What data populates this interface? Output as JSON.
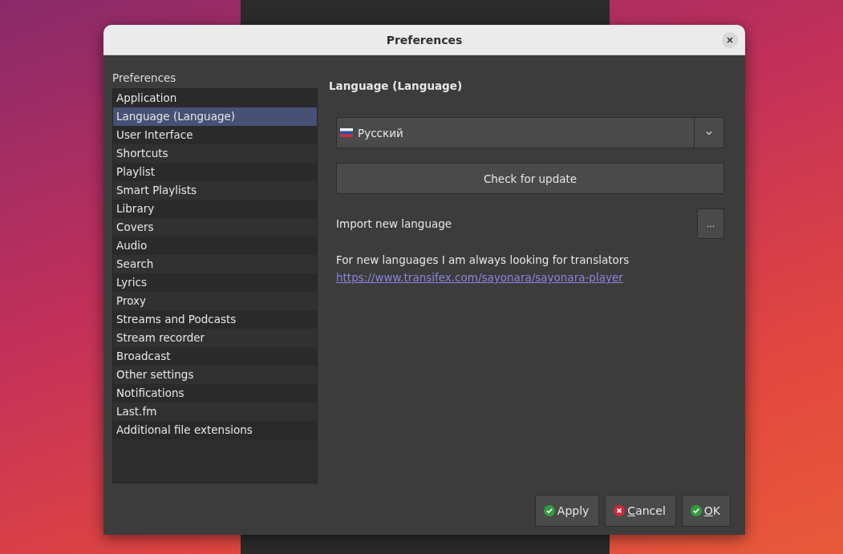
{
  "window": {
    "title": "Preferences"
  },
  "sidebar": {
    "heading": "Preferences",
    "items": [
      {
        "label": "Application",
        "selected": false
      },
      {
        "label": "Language (Language)",
        "selected": true
      },
      {
        "label": "User Interface",
        "selected": false
      },
      {
        "label": "Shortcuts",
        "selected": false
      },
      {
        "label": "Playlist",
        "selected": false
      },
      {
        "label": "Smart Playlists",
        "selected": false
      },
      {
        "label": "Library",
        "selected": false
      },
      {
        "label": "Covers",
        "selected": false
      },
      {
        "label": "Audio",
        "selected": false
      },
      {
        "label": "Search",
        "selected": false
      },
      {
        "label": "Lyrics",
        "selected": false
      },
      {
        "label": "Proxy",
        "selected": false
      },
      {
        "label": "Streams and Podcasts",
        "selected": false
      },
      {
        "label": "Stream recorder",
        "selected": false
      },
      {
        "label": "Broadcast",
        "selected": false
      },
      {
        "label": "Other settings",
        "selected": false
      },
      {
        "label": "Notifications",
        "selected": false
      },
      {
        "label": "Last.fm",
        "selected": false
      },
      {
        "label": "Additional file extensions",
        "selected": false
      }
    ]
  },
  "page": {
    "title": "Language (Language)",
    "language_select": {
      "value": "Русский"
    },
    "check_button": "Check for update",
    "import_label": "Import new language",
    "import_button": "...",
    "note": "For new languages I am always looking for translators",
    "link": "https://www.transifex.com/sayonara/sayonara-player"
  },
  "buttons": [
    {
      "label": "Apply",
      "kind": "confirm",
      "mnemonic": false
    },
    {
      "label": "Cancel",
      "kind": "cancel",
      "mnemonic": true
    },
    {
      "label": "OK",
      "kind": "confirm",
      "mnemonic": true
    }
  ]
}
